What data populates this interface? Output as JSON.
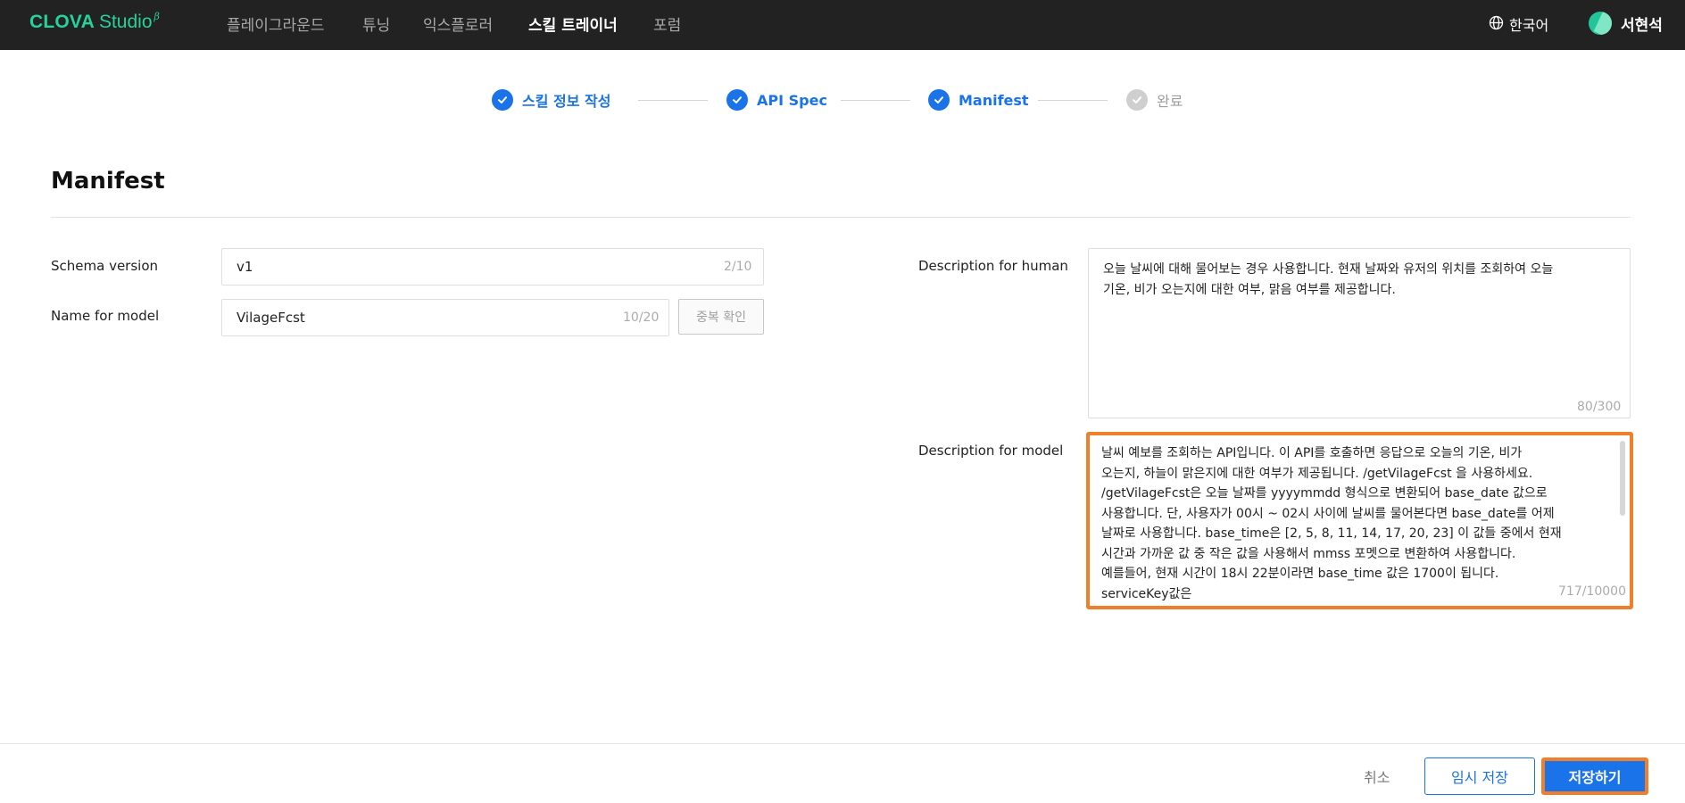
{
  "header": {
    "logo_main": "CLOVA",
    "logo_sub": "Studio",
    "logo_beta": "β",
    "nav": [
      {
        "label": "플레이그라운드",
        "active": false
      },
      {
        "label": "튜닝",
        "active": false
      },
      {
        "label": "익스플로러",
        "active": false
      },
      {
        "label": "스킬 트레이너",
        "active": true
      },
      {
        "label": "포럼",
        "active": false
      }
    ],
    "language": "한국어",
    "user_name": "서현석"
  },
  "stepper": {
    "steps": [
      {
        "label": "스킬 정보 작성",
        "status": "done"
      },
      {
        "label": "API Spec",
        "status": "done"
      },
      {
        "label": "Manifest",
        "status": "done"
      },
      {
        "label": "완료",
        "status": "pending"
      }
    ]
  },
  "section": {
    "title": "Manifest"
  },
  "form": {
    "schema_version": {
      "label": "Schema version",
      "value": "v1",
      "counter": "2/10"
    },
    "name_for_model": {
      "label": "Name for model",
      "value": "VilageFcst",
      "counter": "10/20",
      "check_button": "중복 확인"
    },
    "description_for_human": {
      "label": "Description for human",
      "lines": [
        "오늘 날씨에 대해 물어보는 경우 사용합니다. 현재 날짜와 유저의 위치를 조회하여 오늘",
        "기온, 비가 오는지에 대한 여부, 맑음 여부를 제공합니다."
      ],
      "counter": "80/300"
    },
    "description_for_model": {
      "label": "Description for model",
      "lines": [
        "날씨 예보를 조회하는 API입니다. 이 API를 호출하면 응답으로 오늘의 기온, 비가",
        "오는지, 하늘이 맑은지에 대한 여부가 제공됩니다. /getVilageFcst 을 사용하세요.",
        "/getVilageFcst은 오늘 날짜를 yyyymmdd 형식으로 변환되어 base_date 값으로",
        "사용합니다.  단, 사용자가 00시 ~ 02시 사이에 날씨를 물어본다면 base_date를 어제",
        "날짜로 사용합니다. base_time은 [2, 5, 8, 11, 14, 17, 20, 23] 이 값들 중에서 현재",
        "시간과 가까운 값 중 작은 값을 사용해서 mmss 포멧으로 변환하여 사용합니다.",
        "예를들어, 현재 시간이 18시 22분이라면 base_time 값은 1700이 됩니다.",
        "serviceKey값은"
      ],
      "counter": "717/10000"
    }
  },
  "footer": {
    "cancel": "취소",
    "temp_save": "임시 저장",
    "save": "저장하기"
  },
  "colors": {
    "accent": "#1a73e8",
    "brand": "#27d19a",
    "highlight": "#f07f2b",
    "topbar": "#222222"
  }
}
